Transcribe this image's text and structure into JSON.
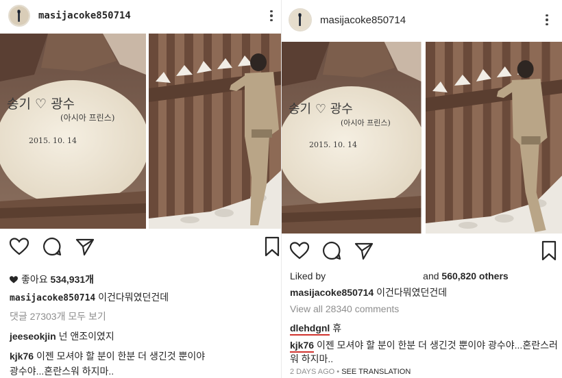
{
  "left": {
    "username": "masijacoke850714",
    "likes_label": "좋아요",
    "likes_count": "534,931개",
    "caption_user": "masijacoke850714",
    "caption_text": "이건다뭐였던건데",
    "view_comments": "댓글 27303개 모두 보기",
    "comments": [
      {
        "user": "jeeseokjin",
        "text": "넌 앤조이였지"
      },
      {
        "user": "kjk76",
        "text": "이젠 모셔야 할 분이 한분 더 생긴것 뿐이야"
      },
      {
        "user": "",
        "text": "광수야...혼란스워 하지마.."
      }
    ],
    "rock_line1": "송기 ♡ 광수",
    "rock_line2": "(아시아 프린스)",
    "rock_date": "2015. 10. 14"
  },
  "right": {
    "username": "masijacoke850714",
    "liked_by_label": "Liked by",
    "and_label": "and",
    "others_count": "560,820 others",
    "caption_user": "masijacoke850714",
    "caption_text": "이건다뭐였던건데",
    "view_comments": "View all 28340 comments",
    "comments": [
      {
        "user": "dlehdgnl",
        "text": "휴"
      },
      {
        "user": "kjk76",
        "text": "이젠 모셔야 할 분이 한분 더 생긴것 뿐이야 광수야...혼란스러"
      },
      {
        "user": "",
        "text": "워 하지마.."
      }
    ],
    "timestamp": "2 DAYS AGO",
    "dot": "•",
    "see_translation": "SEE TRANSLATION",
    "rock_line1": "송기 ♡ 광수",
    "rock_line2": "(아시아 프린스)",
    "rock_date": "2015. 10. 14"
  },
  "icons": [
    "avatar",
    "more-options-icon",
    "heart-icon",
    "comment-icon",
    "share-icon",
    "bookmark-icon"
  ],
  "colors": {
    "text": "#262626",
    "muted": "#8e8e8e",
    "underline": "#d0312d",
    "border": "#eaeaea"
  }
}
